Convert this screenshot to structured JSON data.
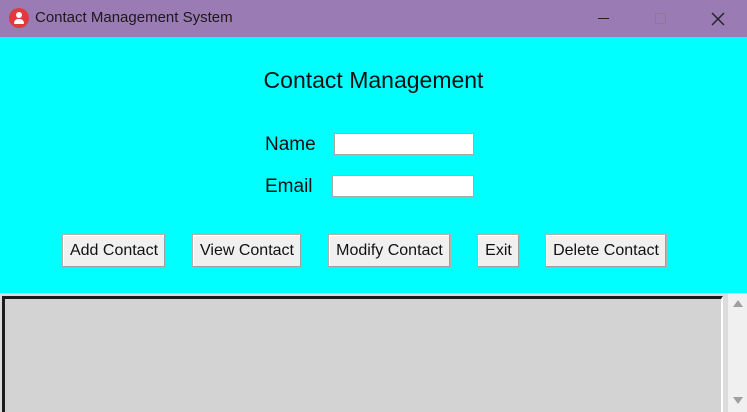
{
  "window": {
    "title": "Contact Management System",
    "app_icon": "user-icon",
    "controls": [
      "minimize-icon",
      "maximize-icon",
      "close-icon"
    ],
    "titlebar_color": "#9b7bb4"
  },
  "form": {
    "heading": "Contact Management",
    "name_label": "Name",
    "name_value": "",
    "email_label": "Email",
    "email_value": "",
    "background_color": "#00ffff"
  },
  "buttons": {
    "add": "Add Contact",
    "view": "View Contact",
    "modify": "Modify Contact",
    "exit": "Exit",
    "delete": "Delete Contact"
  },
  "listbox": {
    "items": []
  },
  "icons": {
    "close_glyph": "✕"
  }
}
